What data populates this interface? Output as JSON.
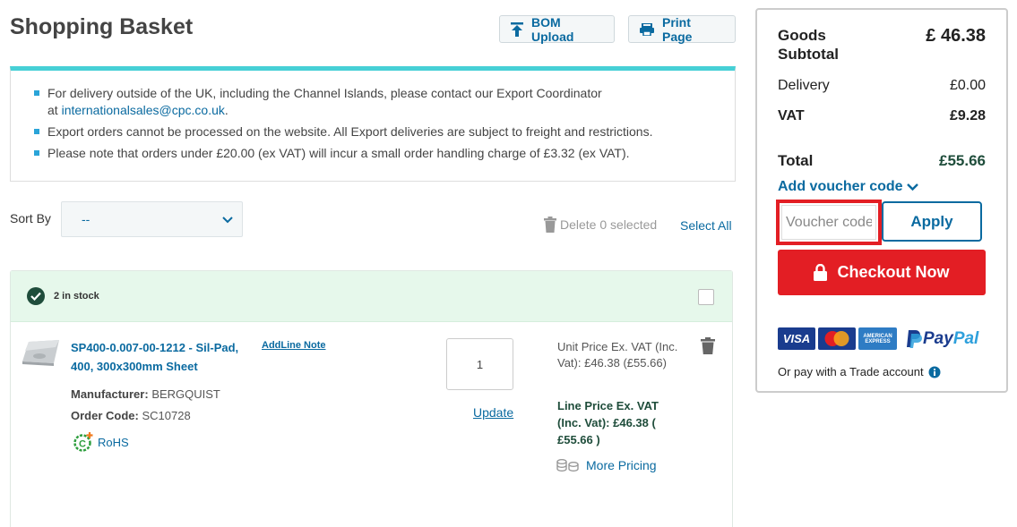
{
  "page": {
    "title": "Shopping Basket"
  },
  "toolbar": {
    "bom_upload": "BOM Upload",
    "print_page": "Print Page"
  },
  "notice": {
    "line1_text": "For delivery outside of the UK, including the Channel Islands, please contact our Export Coordinator",
    "line1_at": "at",
    "line1_email": "internationalsales@cpc.co.uk",
    "line1_end": ".",
    "line2": "Export orders cannot be processed on the website. All Export deliveries are subject to freight and restrictions.",
    "line3": "Please note that orders under £20.00 (ex VAT) will incur a small order handling charge of £3.32 (ex VAT)."
  },
  "controls": {
    "sort_label": "Sort By",
    "sort_value": "--",
    "delete_selected": "Delete 0 selected",
    "select_all": "Select All"
  },
  "item": {
    "stock": "2 in stock",
    "name": "SP400-0.007-00-1212 - Sil-Pad, 400, 300x300mm Sheet",
    "add_line_note": "AddLine Note",
    "manufacturer_label": "Manufacturer:",
    "manufacturer": "BERGQUIST",
    "order_code_label": "Order Code:",
    "order_code": "SC10728",
    "rohs": "RoHS",
    "quantity": "1",
    "update": "Update",
    "unit_price": "Unit Price Ex. VAT (Inc. Vat): £46.38 (£55.66)",
    "line_price": "Line Price Ex. VAT (Inc. Vat): £46.38 ( £55.66 )",
    "more_pricing": "More Pricing"
  },
  "summary": {
    "subtotal_label": "Goods Subtotal",
    "subtotal_value": "£ 46.38",
    "delivery_label": "Delivery",
    "delivery_value": "£0.00",
    "vat_label": "VAT",
    "vat_value": "£9.28",
    "total_label": "Total",
    "total_value": "£55.66",
    "add_voucher": "Add voucher code",
    "voucher_placeholder": "Voucher code",
    "apply": "Apply",
    "checkout": "Checkout Now",
    "trade": "Or pay with a Trade account"
  },
  "payment_logos": {
    "visa": "VISA",
    "amex": "AMERICAN EXPRESS",
    "paypal_pay": "Pay",
    "paypal_pal": "Pal"
  },
  "colors": {
    "brand_blue": "#0a6aa0",
    "accent_teal": "#46d0d6",
    "checkout_red": "#e31e24",
    "stock_green": "#1f4d3b"
  },
  "icons": [
    "upload-icon",
    "printer-icon",
    "chevron-down-icon",
    "trash-icon",
    "check-circle-icon",
    "rohs-icon",
    "coins-icon",
    "lock-icon",
    "info-icon"
  ]
}
